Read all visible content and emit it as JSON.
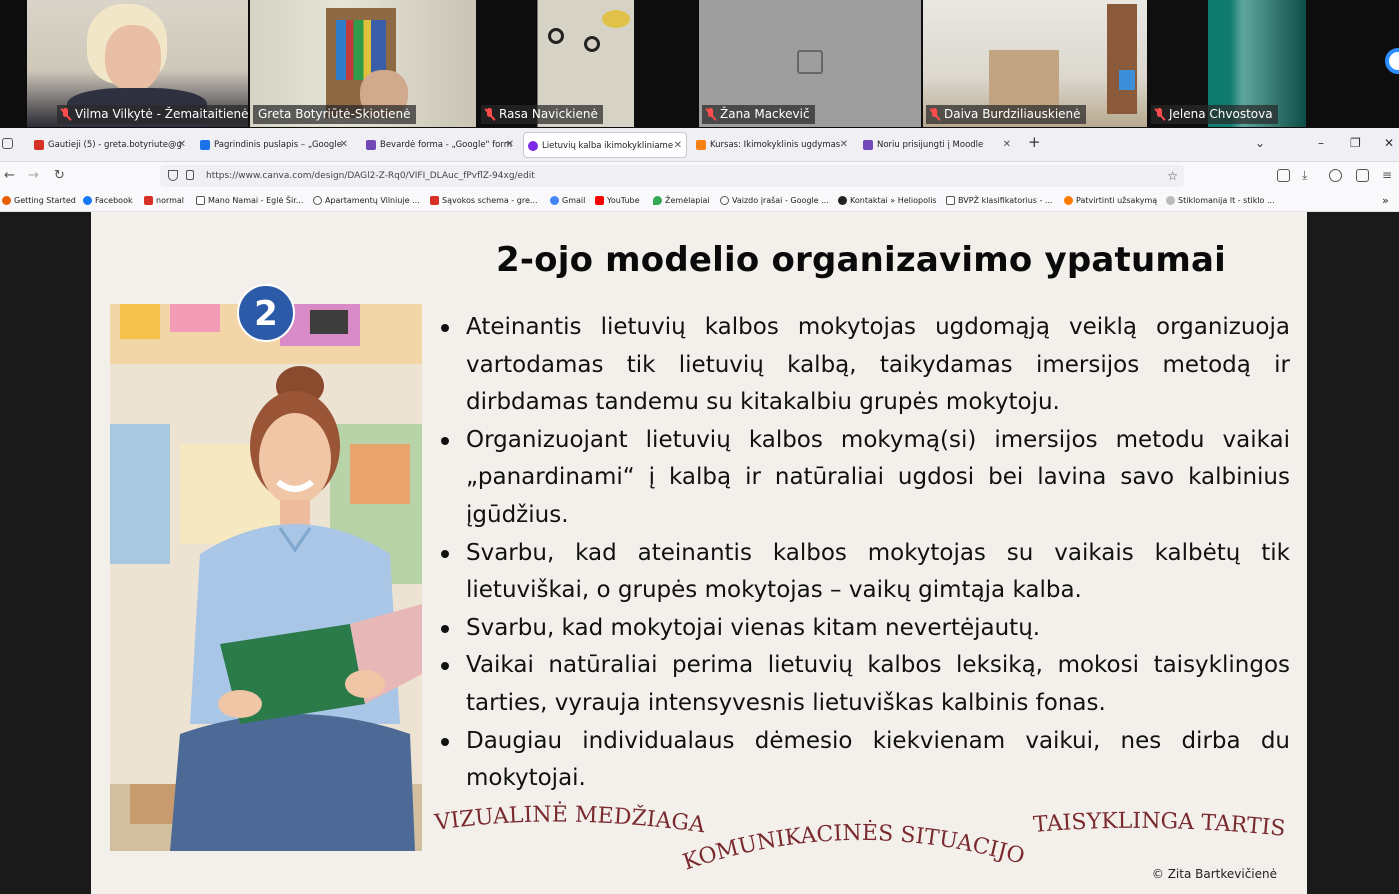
{
  "participants": [
    {
      "name": "Vilma Vilkytė - Žemaitaitienė",
      "muted": true
    },
    {
      "name": "Greta Botyriūtė-Skiotienė",
      "muted": false,
      "active": true
    },
    {
      "name": "Rasa Navickienė",
      "muted": true
    },
    {
      "name": "Žana Mackevič",
      "muted": true,
      "camera": "off"
    },
    {
      "name": "Daiva Burdziliauskienė",
      "muted": true
    },
    {
      "name": "Jelena Chvostova",
      "muted": true
    }
  ],
  "browser": {
    "tabs": [
      {
        "label": "Gautieji (5) - greta.botyriute@g",
        "icon": "gmail-icon",
        "color": "#d93025"
      },
      {
        "label": "Pagrindinis puslapis – „Google",
        "icon": "drive-icon",
        "color": "#1a73e8"
      },
      {
        "label": "Bevardė forma - „Google\" form",
        "icon": "forms-icon",
        "color": "#7248b9"
      },
      {
        "label": "Lietuvių kalba ikimokykliniame",
        "icon": "canva-icon",
        "color": "#7d2ae8",
        "active": true
      },
      {
        "label": "Kursas: Ikimokyklinis ugdymas",
        "icon": "moodle-icon",
        "color": "#f98012"
      },
      {
        "label": "Noriu prisijungti į Moodle",
        "icon": "forms-icon",
        "color": "#7248b9"
      }
    ],
    "url": "https://www.canva.com/design/DAGl2-Z-Rq0/VIFI_DLAuc_fPvflZ-94xg/edit",
    "bookmarks": [
      {
        "label": "Getting Started",
        "color": "#e66000"
      },
      {
        "label": "Facebook",
        "color": "#1877f2"
      },
      {
        "label": "normal",
        "color": "#d93025"
      },
      {
        "label": "Mano Namai - Eglė Šir...",
        "color": "#555555"
      },
      {
        "label": "Apartamentų Vilniuje ...",
        "color": "#555555"
      },
      {
        "label": "Sąvokos schema - gre...",
        "color": "#d93025"
      },
      {
        "label": "Gmail",
        "color": "#4285f4"
      },
      {
        "label": "YouTube",
        "color": "#ff0000"
      },
      {
        "label": "Žemėlapiai",
        "color": "#34a853"
      },
      {
        "label": "Vaizdo įrašai - Google ...",
        "color": "#555555"
      },
      {
        "label": "Kontaktai » Heliopolis",
        "color": "#222222"
      },
      {
        "label": "BVPŽ klasifikatorius - ...",
        "color": "#555555"
      },
      {
        "label": "Patvirtinti užsakymą",
        "color": "#ff7a00"
      },
      {
        "label": "Stiklomanija lt - stiklo ...",
        "color": "#999999"
      }
    ]
  },
  "slide": {
    "title": "2-ojo modelio organizavimo ypatumai",
    "badge": "2",
    "bullets": [
      "Ateinantis lietuvių kalbos mokytojas ugdomąją veiklą organizuoja vartodamas tik lietuvių kalbą, taikydamas imersijos metodą ir dirbdamas tandemu su kitakalbiu grupės mokytoju.",
      "Organizuojant lietuvių kalbos mokymą(si) imersijos metodu vaikai „panardinami“ į kalbą ir natūraliai ugdosi bei lavina savo kalbinius įgūdžius.",
      "Svarbu, kad ateinantis kalbos mokytojas su vaikais kalbėtų tik lietuviškai, o grupės mokytojas – vaikų gimtąja kalba.",
      "Svarbu, kad mokytojai vienas kitam nevertėjautų.",
      "Vaikai natūraliai perima lietuvių kalbos leksiką, mokosi taisyklingos tarties, vyrauja intensyvesnis lietuviškas kalbinis fonas.",
      "Daugiau individualaus dėmesio kiekvienam vaikui, nes dirba du mokytojai."
    ],
    "curved_labels": [
      "VIZUALINĖ MEDŽIAGA",
      "KOMUNIKACINĖS SITUACIJOS",
      "TAISYKLINGA TARTIS"
    ],
    "accent_color": "#7a2a2e",
    "copyright": "© Zita Bartkevičienė"
  }
}
